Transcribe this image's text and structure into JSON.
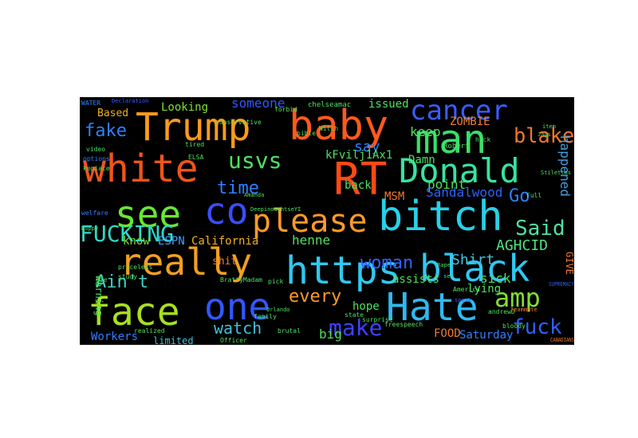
{
  "colors": {
    "background": "#000000",
    "page": "#ffffff"
  },
  "words": [
    {
      "text": "Trump",
      "color": "#ff9a1a"
    },
    {
      "text": "baby",
      "color": "#ff5a1a"
    },
    {
      "text": "man",
      "color": "#39e06a"
    },
    {
      "text": "white",
      "color": "#f0541a"
    },
    {
      "text": "RT",
      "color": "#ff4a14"
    },
    {
      "text": "Donald",
      "color": "#37e3a0"
    },
    {
      "text": "cancer",
      "color": "#3a5cff"
    },
    {
      "text": "bitch",
      "color": "#28d0e8"
    },
    {
      "text": "see",
      "color": "#68e830"
    },
    {
      "text": "co",
      "color": "#3a4eff"
    },
    {
      "text": "please",
      "color": "#ff9a2a"
    },
    {
      "text": "really",
      "color": "#f0a020"
    },
    {
      "text": "https",
      "color": "#30c8f0"
    },
    {
      "text": "black",
      "color": "#30c8f0"
    },
    {
      "text": "one",
      "color": "#3058ff"
    },
    {
      "text": "Hate",
      "color": "#30b8f0"
    },
    {
      "text": "face",
      "color": "#a8e020"
    },
    {
      "text": "FUCKING",
      "color": "#30d8c8"
    },
    {
      "text": "usvs",
      "color": "#50e060"
    },
    {
      "text": "time",
      "color": "#3080ff"
    },
    {
      "text": "blake",
      "color": "#f07830"
    },
    {
      "text": "fake",
      "color": "#3080ff"
    },
    {
      "text": "woman",
      "color": "#3060ff"
    },
    {
      "text": "make",
      "color": "#4040ff"
    },
    {
      "text": "amp",
      "color": "#80e030"
    },
    {
      "text": "Ain't",
      "color": "#40d0c0"
    },
    {
      "text": "Said",
      "color": "#50e0a0"
    },
    {
      "text": "fuck",
      "color": "#3060ff"
    },
    {
      "text": "Go",
      "color": "#3080ff"
    },
    {
      "text": "Shirt",
      "color": "#40c0e0"
    },
    {
      "text": "AGHCID",
      "color": "#50e080"
    },
    {
      "text": "every",
      "color": "#ff9a2a"
    },
    {
      "text": "watch",
      "color": "#40c0e0"
    },
    {
      "text": "California",
      "color": "#f0b020"
    },
    {
      "text": "ESPN",
      "color": "#40a0ff"
    },
    {
      "text": "know",
      "color": "#80e030"
    },
    {
      "text": "Based",
      "color": "#f0b020"
    },
    {
      "text": "Looking",
      "color": "#80e030"
    },
    {
      "text": "someone",
      "color": "#3058ff"
    },
    {
      "text": "shit",
      "color": "#f08030"
    },
    {
      "text": "say",
      "color": "#3080ff"
    },
    {
      "text": "keep",
      "color": "#50e060"
    },
    {
      "text": "point",
      "color": "#50e060"
    },
    {
      "text": "back",
      "color": "#50e060"
    },
    {
      "text": "issued",
      "color": "#50e060"
    },
    {
      "text": "ZOMBIE",
      "color": "#f08030"
    },
    {
      "text": "happened",
      "color": "#40a0e0"
    },
    {
      "text": "sick",
      "color": "#50e060"
    },
    {
      "text": "kFvilj1Ax1",
      "color": "#50e060"
    },
    {
      "text": "Sandalwood",
      "color": "#3060ff"
    },
    {
      "text": "Damn",
      "color": "#50e060"
    },
    {
      "text": "MSM",
      "color": "#f07830"
    },
    {
      "text": "henne",
      "color": "#50e060"
    },
    {
      "text": "assists",
      "color": "#50e060"
    },
    {
      "text": "lying",
      "color": "#50e060"
    },
    {
      "text": "hope",
      "color": "#50e060"
    },
    {
      "text": "big",
      "color": "#50e060"
    },
    {
      "text": "FOOD",
      "color": "#f07830"
    },
    {
      "text": "Saturday",
      "color": "#3080ff"
    },
    {
      "text": "Workers",
      "color": "#3080ff"
    },
    {
      "text": "limited",
      "color": "#40c0e0"
    },
    {
      "text": "warning",
      "color": "#50e060"
    },
    {
      "text": "GIVE",
      "color": "#f07830"
    },
    {
      "text": "chelseamac",
      "color": "#50e060"
    },
    {
      "text": "conservative",
      "color": "#50e060"
    },
    {
      "text": "bible",
      "color": "#50e060"
    },
    {
      "text": "Witch",
      "color": "#50e060"
    },
    {
      "text": "Robert",
      "color": "#50e060"
    },
    {
      "text": "hack",
      "color": "#50e060"
    },
    {
      "text": "video",
      "color": "#50e060"
    },
    {
      "text": "options",
      "color": "#3080ff"
    },
    {
      "text": "kepiace",
      "color": "#50e060"
    },
    {
      "text": "tired",
      "color": "#50e060"
    },
    {
      "text": "ELSA",
      "color": "#50e060"
    },
    {
      "text": "welfare",
      "color": "#3080ff"
    },
    {
      "text": "pick",
      "color": "#50e060"
    },
    {
      "text": "state",
      "color": "#50e060"
    },
    {
      "text": "surprise",
      "color": "#50e060"
    },
    {
      "text": "America",
      "color": "#50e060"
    },
    {
      "text": "bloody",
      "color": "#50e060"
    },
    {
      "text": "andrewD",
      "color": "#50e060"
    },
    {
      "text": "brutal",
      "color": "#50e060"
    },
    {
      "text": "study",
      "color": "#50e060"
    },
    {
      "text": "priceless",
      "color": "#50e060"
    },
    {
      "text": "realized",
      "color": "#50e060"
    },
    {
      "text": "Officer",
      "color": "#50e060"
    },
    {
      "text": "family",
      "color": "#50e060"
    },
    {
      "text": "freespeech",
      "color": "#50e060"
    },
    {
      "text": "Amanda",
      "color": "#50e060"
    },
    {
      "text": "forbid",
      "color": "#50e060"
    },
    {
      "text": "WATER",
      "color": "#3080ff"
    },
    {
      "text": "Declaration",
      "color": "#3060ff"
    },
    {
      "text": "Full",
      "color": "#50e060"
    },
    {
      "text": "Hoppy",
      "color": "#50e060"
    },
    {
      "text": "die",
      "color": "#50e060"
    },
    {
      "text": "item",
      "color": "#50e060"
    },
    {
      "text": "Jags",
      "color": "#50e060"
    },
    {
      "text": "Orlando",
      "color": "#50e060"
    },
    {
      "text": "Rape",
      "color": "#50e060"
    },
    {
      "text": "sex",
      "color": "#50e060"
    },
    {
      "text": "Stilettos",
      "color": "#50e060"
    },
    {
      "text": "DeepinoughtseYI",
      "color": "#50e060"
    },
    {
      "text": "BrattyMadam",
      "color": "#50e060"
    },
    {
      "text": "speak",
      "color": "#3060ff"
    },
    {
      "text": "Teammate",
      "color": "#f07830"
    },
    {
      "text": "CANADIANS",
      "color": "#f07830"
    },
    {
      "text": "SUPREMACY",
      "color": "#3060ff"
    }
  ]
}
